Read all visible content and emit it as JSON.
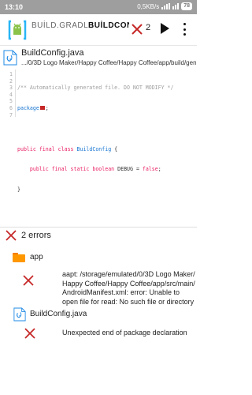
{
  "status_bar": {
    "time": "13:10",
    "network_speed": "0,5KB/s",
    "battery": "78"
  },
  "toolbar": {
    "tab_inactive": "BUİLD.GRADLE",
    "tab_active": "BUİLDCONFİG.JAVA",
    "error_count": "2"
  },
  "file": {
    "name": "BuildConfig.java",
    "path": ".../0/3D Logo Maker/Happy Coffee/Happy Coffee/app/build/gen"
  },
  "code": {
    "line_numbers": [
      "1",
      "2",
      "3",
      "4",
      "5",
      "6",
      "7"
    ],
    "line1": "/** Automatically generated file. DO NOT MODIFY */",
    "line2_kw": "package",
    "line2_end": ";",
    "line4_kw1": "public",
    "line4_kw2": "final",
    "line4_kw3": "class",
    "line4_type": "BuildConfig",
    "line4_end": " {",
    "line5_kw1": "public",
    "line5_kw2": "final",
    "line5_kw3": "static",
    "line5_type": "boolean",
    "line5_name": " DEBUG = ",
    "line5_val": "false",
    "line5_end": ";",
    "line6": "}"
  },
  "errors_panel": {
    "header": "2 errors",
    "group1": {
      "label": "app",
      "message": "aapt: /storage/emulated/0/3D Logo Maker/ Happy Coffee/Happy Coffee/app/src/main/ AndroidManifest.xml: error: Unable to open file for read: No such file or directory"
    },
    "group2": {
      "label": "BuildConfig.java",
      "message": "Unexpected end of package declaration"
    }
  },
  "colors": {
    "error_red": "#c62828",
    "folder_orange": "#ff9800",
    "keyword_pink": "#e91e63",
    "type_blue": "#1976d2",
    "statusbar_gray": "#9e9e9e"
  }
}
